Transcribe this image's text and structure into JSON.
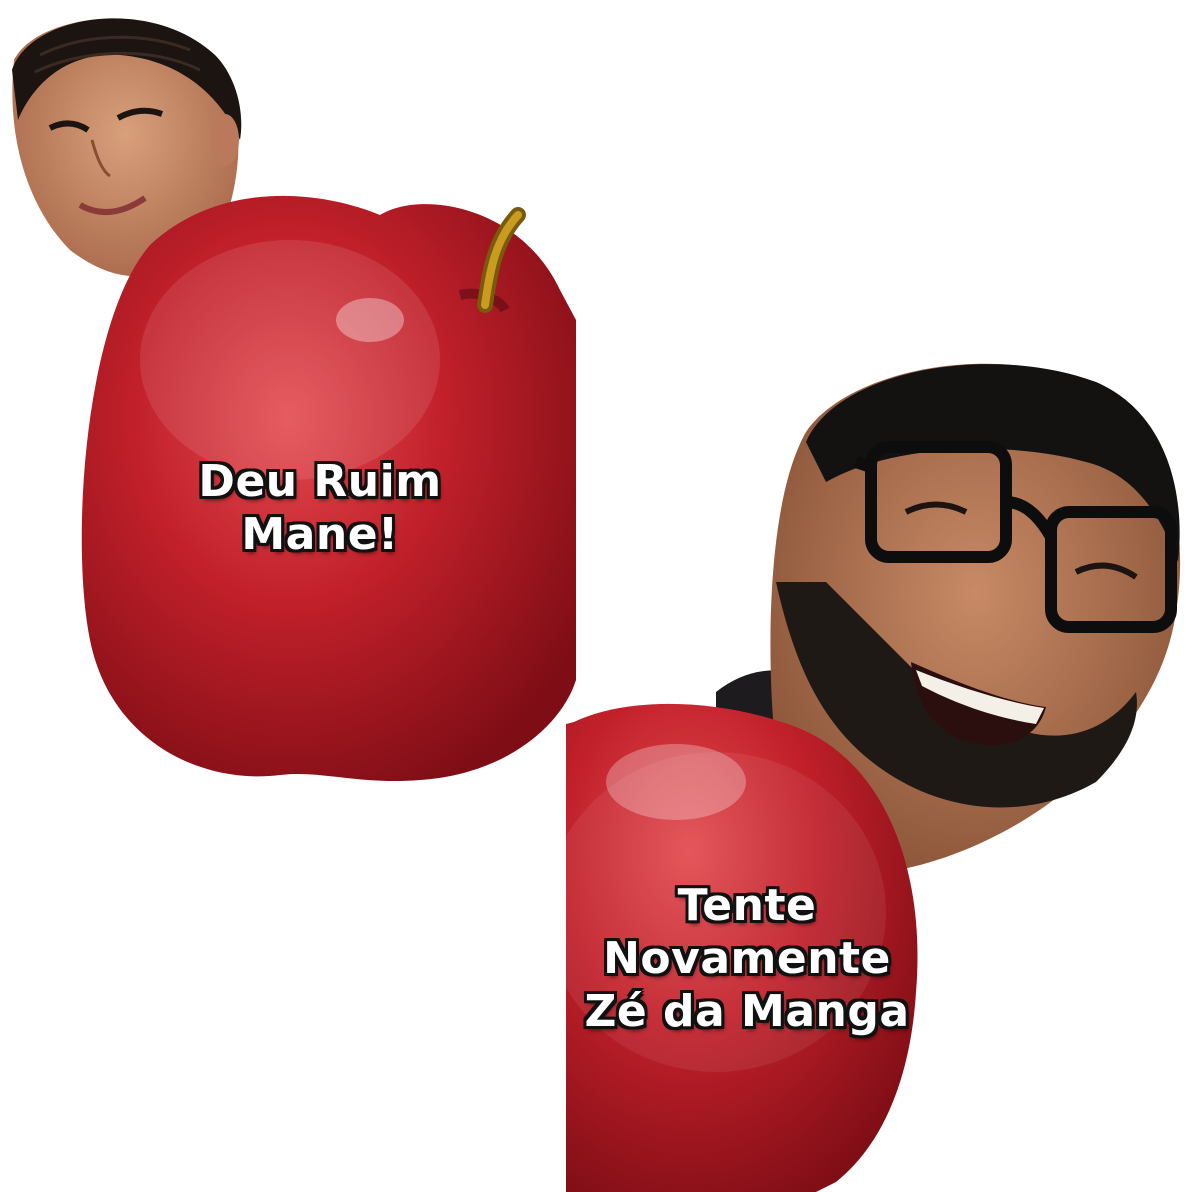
{
  "stickers": {
    "left": {
      "person": "woman-face",
      "fruit": "red-apple",
      "caption_lines": [
        "Deu Ruim",
        "Mane!"
      ]
    },
    "right": {
      "person": "bearded-man-with-glasses",
      "fruit": "red-apple",
      "caption_lines": [
        "Tente",
        "Novamente",
        "Zé da Manga"
      ]
    }
  },
  "colors": {
    "background": "#ffffff",
    "apple_red": "#c1202a",
    "apple_dark": "#7e0d15",
    "caption_text": "#ffffff",
    "caption_outline": "#111111"
  }
}
